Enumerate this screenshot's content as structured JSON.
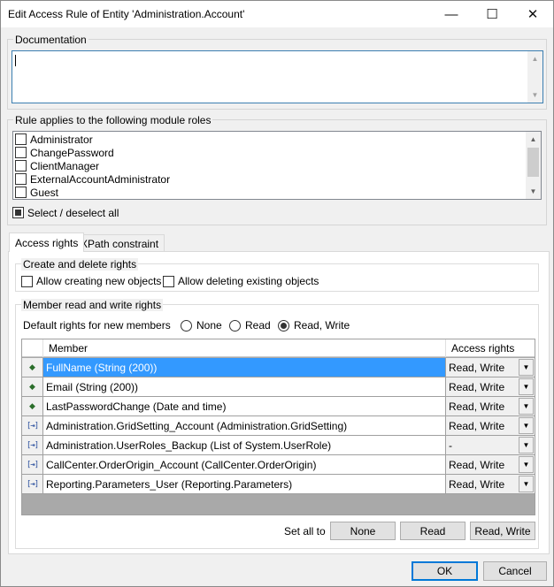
{
  "window": {
    "title": "Edit Access Rule of Entity 'Administration.Account'",
    "minimize_glyph": "—",
    "maximize_glyph": "☐",
    "close_glyph": "✕"
  },
  "documentation": {
    "label": "Documentation",
    "value": ""
  },
  "module_roles": {
    "label": "Rule applies to the following module roles",
    "items": [
      {
        "label": "Administrator",
        "checked": false
      },
      {
        "label": "ChangePassword",
        "checked": false
      },
      {
        "label": "ClientManager",
        "checked": false
      },
      {
        "label": "ExternalAccountAdministrator",
        "checked": false
      },
      {
        "label": "Guest",
        "checked": false
      }
    ],
    "select_all_label": "Select / deselect all"
  },
  "tabs": [
    {
      "label": "Access rights",
      "active": true
    },
    {
      "label": "XPath constraint",
      "active": false
    }
  ],
  "create_delete": {
    "label": "Create and delete rights",
    "allow_create": "Allow creating new objects",
    "allow_delete": "Allow deleting existing objects"
  },
  "member_rights": {
    "label": "Member read and write rights",
    "default_label": "Default rights for new members",
    "options": [
      "None",
      "Read",
      "Read, Write"
    ],
    "selected": "Read, Write",
    "columns": {
      "member": "Member",
      "access": "Access rights"
    },
    "rows": [
      {
        "member": "FullName (String (200))",
        "access": "Read, Write",
        "icon": "attribute-icon",
        "selected": true
      },
      {
        "member": "Email (String (200))",
        "access": "Read, Write",
        "icon": "attribute-icon",
        "selected": false
      },
      {
        "member": "LastPasswordChange (Date and time)",
        "access": "Read, Write",
        "icon": "attribute-icon",
        "selected": false
      },
      {
        "member": "Administration.GridSetting_Account (Administration.GridSetting)",
        "access": "Read, Write",
        "icon": "association-icon",
        "selected": false
      },
      {
        "member": "Administration.UserRoles_Backup (List of System.UserRole)",
        "access": "-",
        "icon": "association-icon",
        "selected": false
      },
      {
        "member": "CallCenter.OrderOrigin_Account (CallCenter.OrderOrigin)",
        "access": "Read, Write",
        "icon": "association-icon",
        "selected": false
      },
      {
        "member": "Reporting.Parameters_User (Reporting.Parameters)",
        "access": "Read, Write",
        "icon": "association-icon",
        "selected": false
      }
    ],
    "set_all_label": "Set all to",
    "set_all_buttons": [
      "None",
      "Read",
      "Read, Write"
    ]
  },
  "footer": {
    "ok": "OK",
    "cancel": "Cancel"
  },
  "colors": {
    "selection": "#3399ff",
    "accent_border": "#0078d7"
  }
}
